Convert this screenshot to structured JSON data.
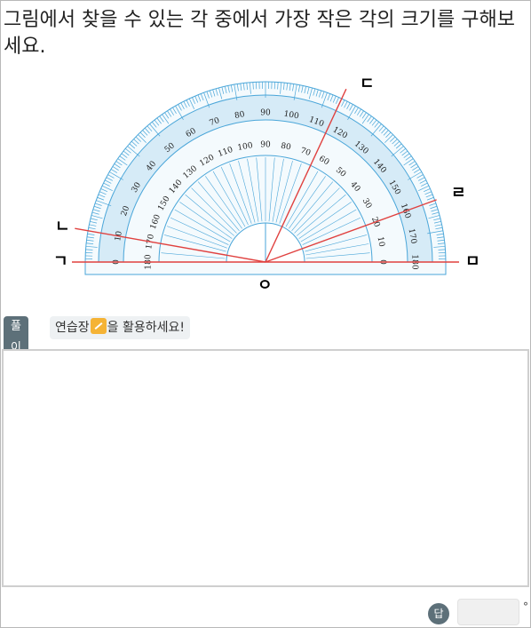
{
  "question": {
    "text": "그림에서 찾을 수 있는 각 중에서 가장 작은 각의 크기를 구해보세요."
  },
  "figure": {
    "point_labels": {
      "giyeok": "ㄱ",
      "nieun": "ㄴ",
      "digeut": "ㄷ",
      "rieul": "ㄹ",
      "mieum": "ㅁ",
      "ieung": "ㅇ"
    },
    "rays": [
      {
        "name": "ray-giyeok",
        "angle_deg": 180
      },
      {
        "name": "ray-nieun",
        "angle_deg": 170
      },
      {
        "name": "ray-digeut",
        "angle_deg": 65
      },
      {
        "name": "ray-rieul",
        "angle_deg": 20
      },
      {
        "name": "ray-mieum",
        "angle_deg": 0
      }
    ],
    "protractor": {
      "outer_scale": [
        0,
        10,
        20,
        30,
        40,
        50,
        60,
        70,
        80,
        90,
        100,
        110,
        120,
        130,
        140,
        150,
        160,
        170,
        180
      ],
      "inner_scale": [
        180,
        170,
        160,
        150,
        140,
        130,
        120,
        110,
        100,
        90,
        80,
        70,
        60,
        50,
        40,
        30,
        20,
        10,
        0
      ]
    },
    "colors": {
      "protractor": "#4aa6d9",
      "protractor_band": "#d6ebf7",
      "rays": "#e0413f"
    }
  },
  "solution": {
    "badge_label": "풀이",
    "hint_before": "연습장",
    "hint_icon": "memo-pad-icon",
    "hint_after": "을 활용하세요!"
  },
  "answer": {
    "badge_label": "답",
    "value": "",
    "unit": "°"
  }
}
